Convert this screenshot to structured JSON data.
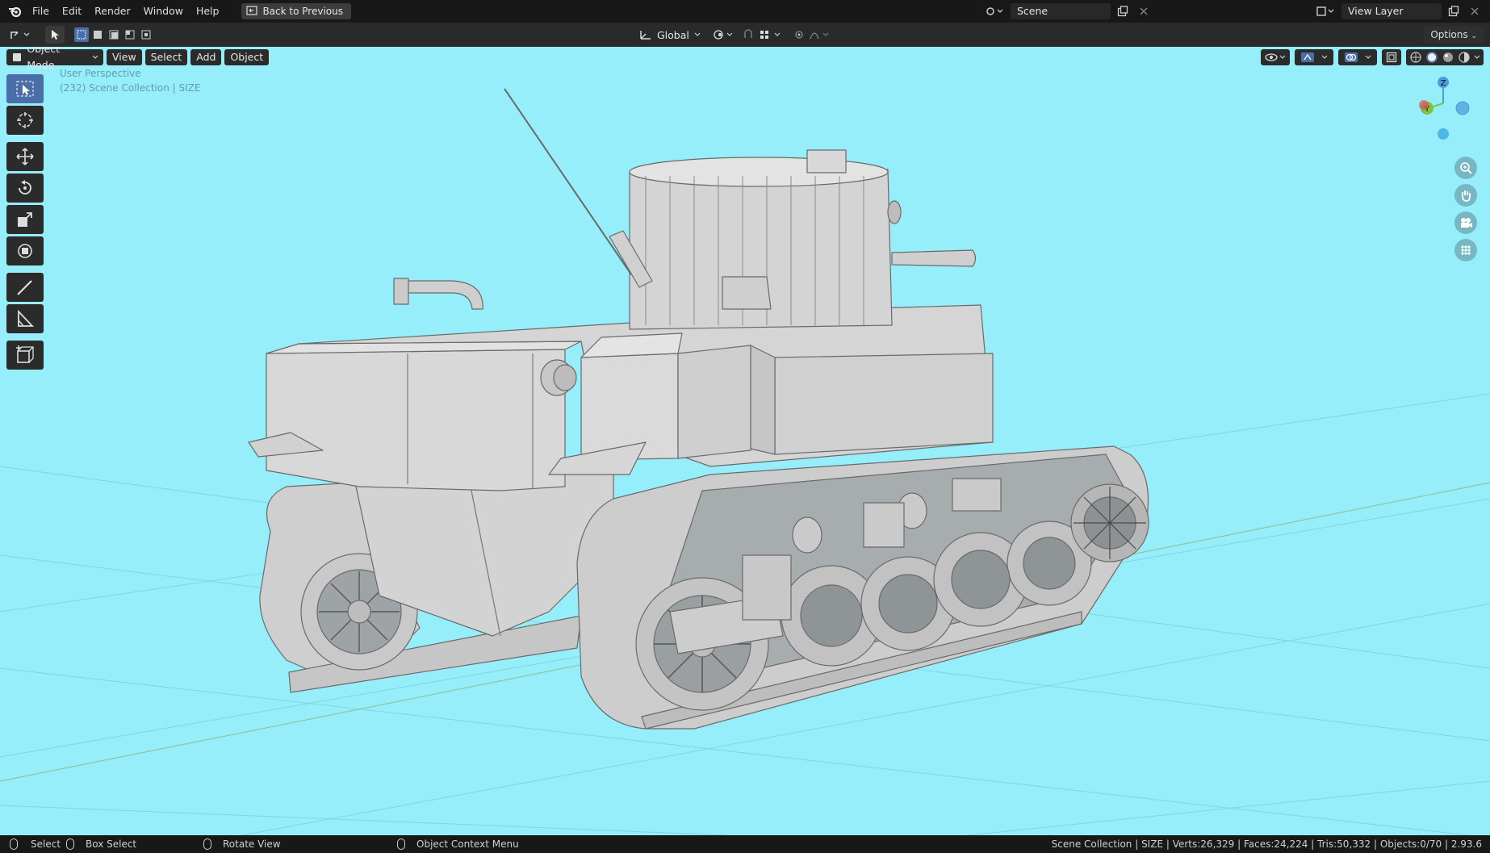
{
  "menu": {
    "items": [
      "File",
      "Edit",
      "Render",
      "Window",
      "Help"
    ],
    "back_label": "Back to Previous"
  },
  "scene": {
    "label": "Scene",
    "view_layer": "View Layer"
  },
  "toolrow": {
    "orientation": "Global",
    "options_label": "Options"
  },
  "viewport_header": {
    "mode": "Object Mode",
    "view": "View",
    "select": "Select",
    "add": "Add",
    "object": "Object"
  },
  "overlay": {
    "perspective": "User Perspective",
    "collection": "(232) Scene Collection | SIZE"
  },
  "gizmo": {
    "z": "Z",
    "y": "Y"
  },
  "statusbar": {
    "select": "Select",
    "box_select": "Box Select",
    "rotate_view": "Rotate View",
    "context_menu": "Object Context Menu",
    "stats": "Scene Collection | SIZE | Verts:26,329 | Faces:24,224 | Tris:50,332 | Objects:0/70 | 2.93.6"
  },
  "colors": {
    "viewport_bg": "#95eefa",
    "header_bg": "#181818",
    "active_tool": "#4a6fa8",
    "axis_z": "#4f9bdb",
    "axis_y": "#7bc441",
    "axis_x": "#e24d5a"
  },
  "icons": {
    "logo": "blender-logo-icon",
    "tools": [
      "select-box-icon",
      "cursor-icon",
      "move-icon",
      "rotate-icon",
      "scale-icon",
      "transform-icon",
      "annotate-icon",
      "measure-icon",
      "add-cube-icon"
    ],
    "nav": [
      "zoom-icon",
      "pan-hand-icon",
      "camera-icon",
      "grid-ortho-icon"
    ]
  }
}
